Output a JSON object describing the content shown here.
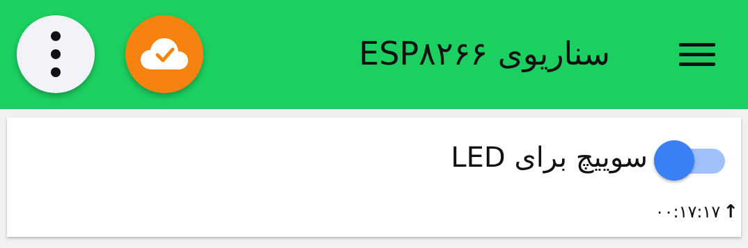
{
  "appbar": {
    "title": "سناریوی ESP۸۲۶۶",
    "background_color": "#1ccf61",
    "menu_icon": "hamburger-menu-icon",
    "cloud_button": {
      "icon": "cloud-check-icon",
      "color": "#f6830f"
    },
    "more_button": {
      "icon": "more-vertical-icon",
      "color": "#f2f3f8"
    }
  },
  "card": {
    "switch": {
      "label": "سوییچ برای LED",
      "state": "off",
      "knob_color": "#3a7ff6",
      "track_color": "#9ec1fb"
    },
    "status": {
      "time": "۰۰:۱۷:۱۷",
      "arrow_icon": "arrow-up-icon"
    }
  }
}
